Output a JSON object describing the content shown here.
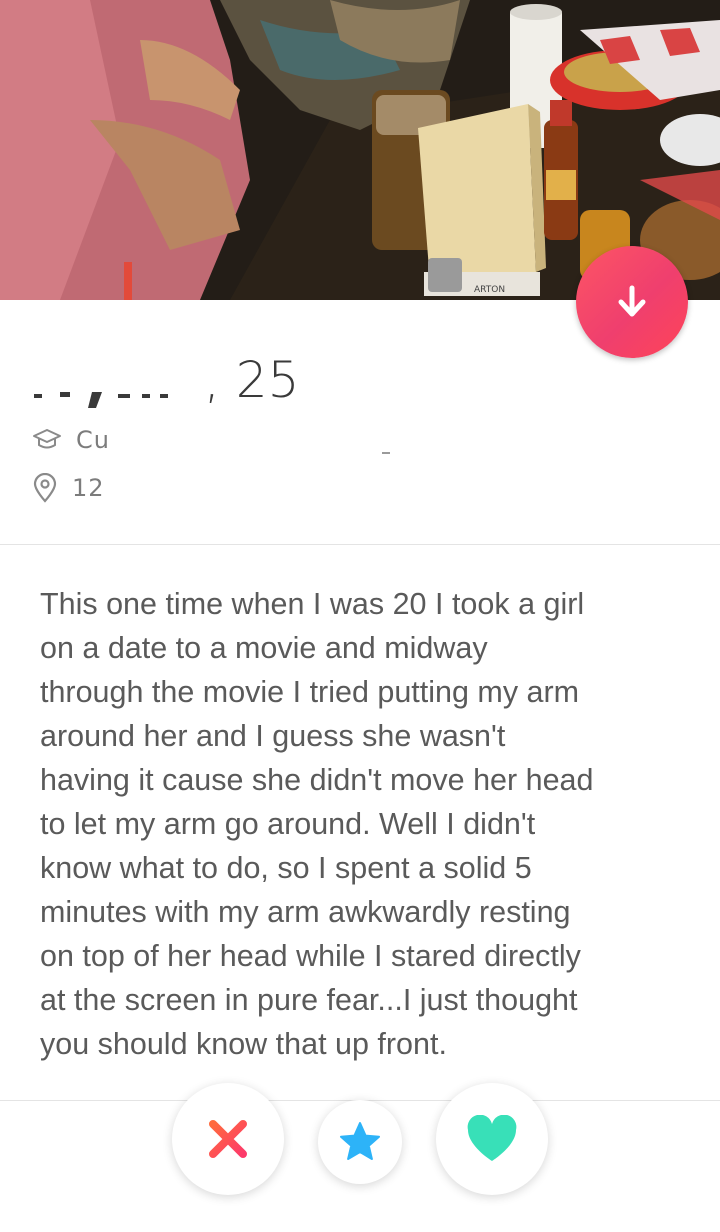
{
  "profile": {
    "age_suffix": ", 25",
    "school_text": "Cu",
    "distance_text": "12"
  },
  "bio": {
    "text": "This one time when I was 20 I took a girl\non a date to a movie and midway\nthrough the movie I tried putting my arm\naround her and I guess she wasn't\nhaving it cause she didn't move her head\nto let my arm go around. Well I didn't\nknow what to do, so I spent a solid 5\nminutes with my arm awkwardly resting\non top of her head while I stared directly\nat the screen in pure fear...I just thought\nyou should know that up front."
  },
  "photo": {
    "sign_text": "ARTON"
  },
  "icons": {
    "collapse": "arrow-down-icon",
    "school": "graduation-cap-icon",
    "location": "location-pin-icon",
    "nope": "x-icon",
    "superlike": "star-icon",
    "like": "heart-icon"
  },
  "colors": {
    "brand_gradient_start": "#fd5564",
    "brand_gradient_end": "#ff4458",
    "nope": "#fd4a5c",
    "superlike": "#2db3f8",
    "like": "#38e0b8"
  }
}
